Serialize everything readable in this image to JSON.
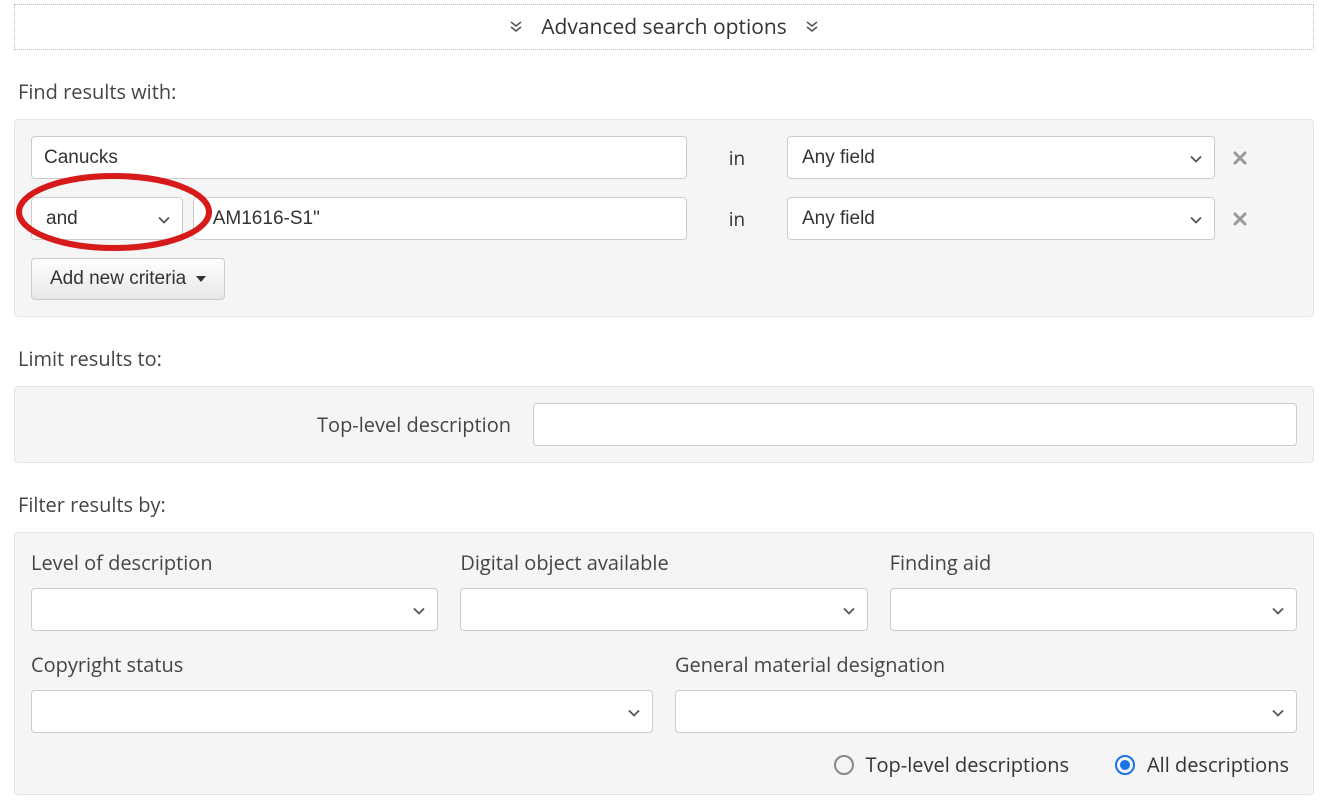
{
  "header": {
    "title": "Advanced search options"
  },
  "find": {
    "section_label": "Find results with:",
    "rows": [
      {
        "operator": "",
        "term": "Canucks",
        "in_label": "in",
        "field": "Any field"
      },
      {
        "operator": "and",
        "term": "\"AM1616-S1\"",
        "in_label": "in",
        "field": "Any field"
      }
    ],
    "add_label": "Add new criteria"
  },
  "limit": {
    "section_label": "Limit results to:",
    "top_level_label": "Top-level description",
    "top_level_value": ""
  },
  "filter": {
    "section_label": "Filter results by:",
    "level_label": "Level of description",
    "level_value": "",
    "digital_label": "Digital object available",
    "digital_value": "",
    "finding_label": "Finding aid",
    "finding_value": "",
    "copyright_label": "Copyright status",
    "copyright_value": "",
    "gmd_label": "General material designation",
    "gmd_value": "",
    "radio_top": "Top-level descriptions",
    "radio_all": "All descriptions",
    "radio_selected": "all"
  }
}
